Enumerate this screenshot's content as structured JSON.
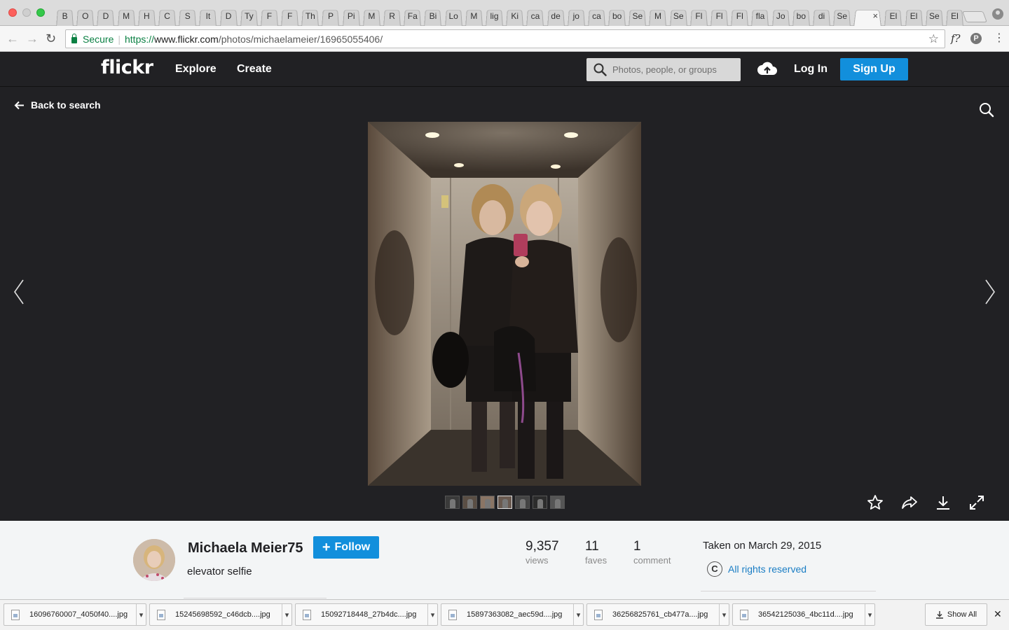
{
  "browser": {
    "tabs": [
      "B",
      "O",
      "D",
      "M",
      "H",
      "C",
      "S",
      "It",
      "D",
      "Ty",
      "F",
      "F",
      "Th",
      "P",
      "Pi",
      "M",
      "R",
      "Fa",
      "Bi",
      "Lo",
      "M",
      "lig",
      "Ki",
      "ca",
      "de",
      "jo",
      "ca",
      "bo",
      "Se",
      "M",
      "Se",
      "Fl",
      "Fl",
      "Fl",
      "fla",
      "Jo",
      "bo",
      "di",
      "Se",
      "",
      "El",
      "El",
      "Se",
      "El"
    ],
    "active_tab_index": 39,
    "active_tab_close": "×",
    "secure_label": "Secure",
    "url_scheme": "https://",
    "url_host": "www.flickr.com",
    "url_path": "/photos/michaelameier/16965055406/",
    "extension_f": "f?",
    "extension_p": "P"
  },
  "header": {
    "logo": "flickr",
    "nav": {
      "explore": "Explore",
      "create": "Create"
    },
    "search_placeholder": "Photos, people, or groups",
    "login": "Log In",
    "signup": "Sign Up"
  },
  "viewer": {
    "back_label": "Back to search",
    "thumbnail_count": 7
  },
  "photo_info": {
    "owner": "Michaela Meier75",
    "follow_label": "Follow",
    "title": "elevator selfie",
    "stats": {
      "views": {
        "value": "9,357",
        "label": "views"
      },
      "faves": {
        "value": "11",
        "label": "faves"
      },
      "comments": {
        "value": "1",
        "label": "comment"
      }
    },
    "taken": "Taken on March 29, 2015",
    "license_icon": "C",
    "license": "All rights reserved"
  },
  "downloads": {
    "items": [
      "16096760007_4050f40....jpg",
      "15245698592_c46dcb....jpg",
      "15092718448_27b4dc....jpg",
      "15897363082_aec59d....jpg",
      "36256825761_cb477a....jpg",
      "36542125036_4bc11d....jpg"
    ],
    "show_all": "Show All"
  },
  "colors": {
    "flickr_blue": "#128fdc",
    "header_bg": "#212124",
    "secure_green": "#0b8043"
  }
}
